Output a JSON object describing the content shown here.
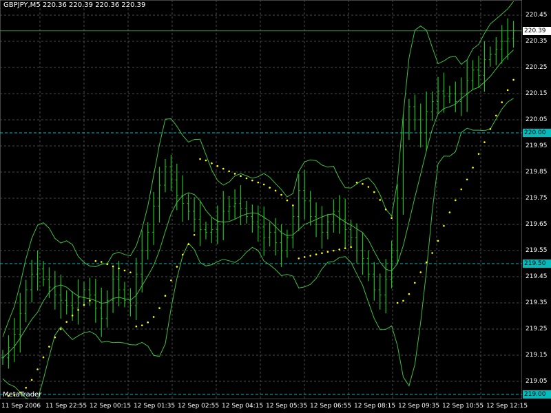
{
  "header": {
    "title": "GBPJPY,M5  220.36 220.39 220.36 220.39"
  },
  "watermark": "MetaTrader",
  "colors": {
    "background": "#000000",
    "grid": "#4a4a4a",
    "candles": "#20c020",
    "bands": "#40c040",
    "sar": "#ffff00",
    "hlines": "#00bcbc",
    "text": "#ffffff",
    "current_price_box": "#ffffff"
  },
  "chart_data": {
    "type": "line",
    "title": "GBPJPY,M5",
    "ylim": [
      219.0,
      220.48
    ],
    "y_ticks": [
      "220.45",
      "220.35",
      "220.25",
      "220.15",
      "220.05",
      "219.95",
      "219.85",
      "219.75",
      "219.65",
      "219.55",
      "219.45",
      "219.35",
      "219.25",
      "219.15",
      "219.05"
    ],
    "x_ticks": [
      "11 Sep 2006",
      "11 Sep 22:55",
      "12 Sep 00:15",
      "12 Sep 01:35",
      "12 Sep 02:55",
      "12 Sep 04:15",
      "12 Sep 05:35",
      "12 Sep 06:55",
      "12 Sep 08:15",
      "12 Sep 09:35",
      "12 Sep 10:55",
      "12 Sep 12:15"
    ],
    "horizontal_lines": [
      {
        "value": "220.00"
      },
      {
        "value": "219.50"
      },
      {
        "value": "219.00"
      }
    ],
    "current_price": "220.39",
    "close_series": [
      219.14,
      219.18,
      219.23,
      219.31,
      219.4,
      219.46,
      219.48,
      219.44,
      219.41,
      219.38,
      219.36,
      219.34,
      219.33,
      219.37,
      219.4,
      219.38,
      219.33,
      219.29,
      219.36,
      219.44,
      219.4,
      219.36,
      219.34,
      219.46,
      219.55,
      219.62,
      219.72,
      219.8,
      219.87,
      219.82,
      219.76,
      219.73,
      219.7,
      219.67,
      219.63,
      219.62,
      219.63,
      219.66,
      219.7,
      219.72,
      219.73,
      219.71,
      219.68,
      219.66,
      219.64,
      219.6,
      219.62,
      219.58,
      219.55,
      219.6,
      219.68,
      219.78,
      219.74,
      219.68,
      219.65,
      219.62,
      219.66,
      219.7,
      219.67,
      219.63,
      219.6,
      219.55,
      219.52,
      219.46,
      219.4,
      219.38,
      219.44,
      219.55,
      219.75,
      220.0,
      220.1,
      220.05,
      220.0,
      220.08,
      220.12,
      220.16,
      220.14,
      220.15,
      220.12,
      220.15,
      220.2,
      220.24,
      220.22,
      220.28,
      220.3,
      220.32,
      220.35,
      220.36,
      220.39
    ],
    "series": [
      {
        "name": "Bollinger Bands"
      },
      {
        "name": "Parabolic SAR"
      }
    ]
  }
}
